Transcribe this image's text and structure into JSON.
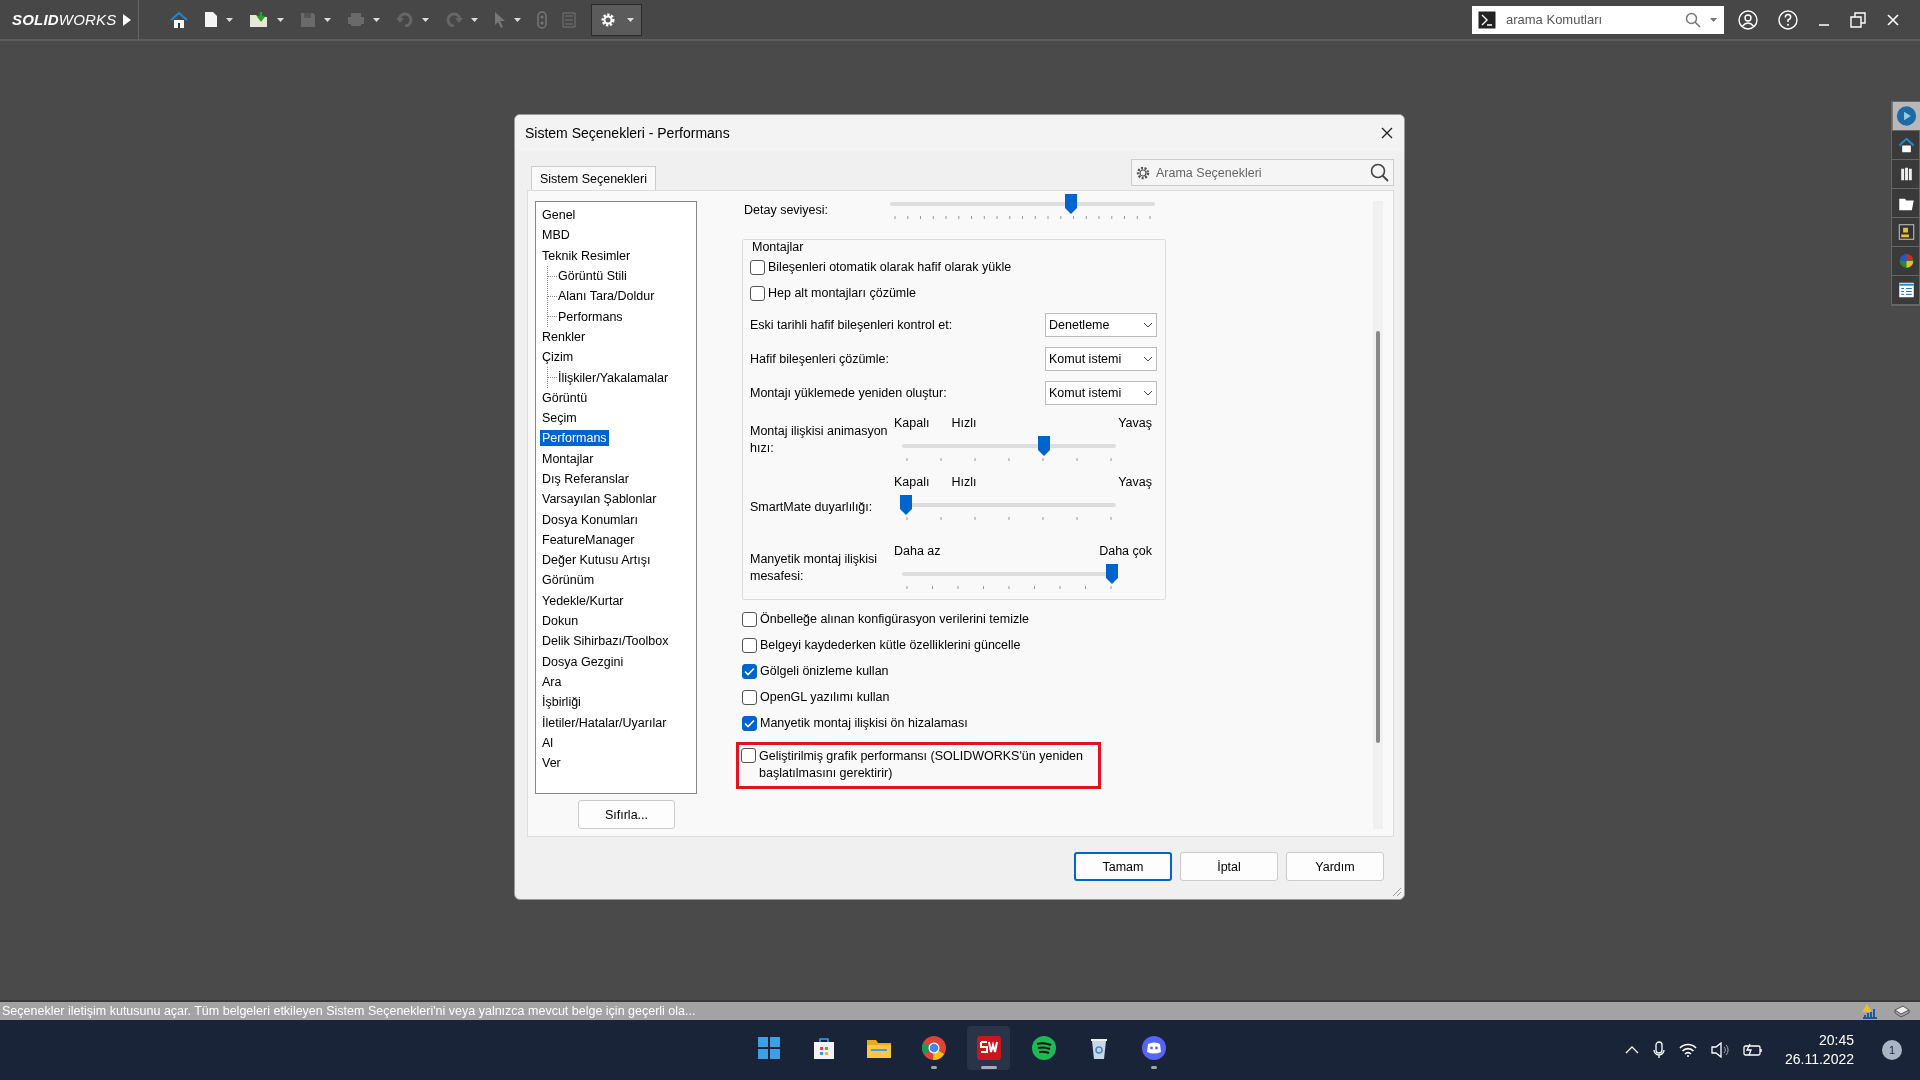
{
  "app": {
    "logo": "**SOLID**WORKS",
    "search": {
      "placeholder": "arama Komutları"
    }
  },
  "dialog": {
    "title": "Sistem Seçenekleri - Performans",
    "tabs": [
      {
        "label": "Sistem Seçenekleri",
        "selected": true
      }
    ],
    "search": {
      "placeholder": "Arama Seçenekleri"
    },
    "tree": [
      {
        "label": "Genel",
        "selected": false
      },
      {
        "label": "MBD",
        "selected": false
      },
      {
        "label": "Teknik Resimler",
        "selected": false,
        "children": [
          {
            "label": "Görüntü Stili",
            "selected": false
          },
          {
            "label": "Alanı Tara/Doldur",
            "selected": false
          },
          {
            "label": "Performans",
            "selected": false
          }
        ]
      },
      {
        "label": "Renkler",
        "selected": false
      },
      {
        "label": "Çizim",
        "selected": false,
        "children": [
          {
            "label": "İlişkiler/Yakalamalar",
            "selected": false
          }
        ]
      },
      {
        "label": "Görüntü",
        "selected": false
      },
      {
        "label": "Seçim",
        "selected": false
      },
      {
        "label": "Performans",
        "selected": true
      },
      {
        "label": "Montajlar",
        "selected": false
      },
      {
        "label": "Dış Referanslar",
        "selected": false
      },
      {
        "label": "Varsayılan Şablonlar",
        "selected": false
      },
      {
        "label": "Dosya Konumları",
        "selected": false
      },
      {
        "label": "FeatureManager",
        "selected": false
      },
      {
        "label": "Değer Kutusu Artışı",
        "selected": false
      },
      {
        "label": "Görünüm",
        "selected": false
      },
      {
        "label": "Yedekle/Kurtar",
        "selected": false
      },
      {
        "label": "Dokun",
        "selected": false
      },
      {
        "label": "Delik Sihirbazı/Toolbox",
        "selected": false
      },
      {
        "label": "Dosya Gezgini",
        "selected": false
      },
      {
        "label": "Ara",
        "selected": false
      },
      {
        "label": "İşbirliği",
        "selected": false
      },
      {
        "label": "İletiler/Hatalar/Uyarılar",
        "selected": false
      },
      {
        "label": "Al",
        "selected": false
      },
      {
        "label": "Ver",
        "selected": false
      }
    ],
    "reset_button": "Sıfırla...",
    "detail": {
      "label": "Detay seviyesi:",
      "level": 0.69
    },
    "group": {
      "title": "Montajlar",
      "checkboxes": [
        {
          "label": "Bileşenleri otomatik olarak hafif olarak yükle",
          "checked": false
        },
        {
          "label": "Hep alt montajları çözümle",
          "checked": false
        }
      ],
      "dropdowns": [
        {
          "label": "Eski tarihli hafif bileşenleri kontrol et:",
          "value": "Denetleme"
        },
        {
          "label": "Hafif bileşenleri çözümle:",
          "value": "Komut istemi"
        },
        {
          "label": "Montajı yüklemede yeniden oluştur:",
          "value": "Komut istemi"
        }
      ],
      "sliders": [
        {
          "label": "Montaj ilişkisi animasyon hızı:",
          "marks": [
            "Kapalı",
            "Hızlı",
            "Yavaş"
          ],
          "level": 0.67
        },
        {
          "label": "SmartMate duyarlılığı:",
          "marks": [
            "Kapalı",
            "Hızlı",
            "Yavaş"
          ],
          "level": 0.0
        },
        {
          "label": "Manyetik montaj ilişkisi mesafesi:",
          "marks": [
            "Daha az",
            "Daha çok"
          ],
          "level": 1.0
        }
      ]
    },
    "options": [
      {
        "label": "Önbelleğe alınan konfigürasyon verilerini temizle",
        "checked": false,
        "highlighted": false
      },
      {
        "label": "Belgeyi kaydederken kütle özelliklerini güncelle",
        "checked": false,
        "highlighted": false
      },
      {
        "label": "Gölgeli önizleme kullan",
        "checked": true,
        "highlighted": false
      },
      {
        "label": "OpenGL yazılımı kullan",
        "checked": false,
        "highlighted": false
      },
      {
        "label": "Manyetik montaj ilişkisi ön hizalaması",
        "checked": true,
        "highlighted": false
      },
      {
        "label": "Geliştirilmiş grafik performansı (SOLIDWORKS'ün yeniden başlatılmasını gerektirir)",
        "checked": false,
        "highlighted": true
      }
    ],
    "buttons": [
      {
        "label": "Tamam",
        "default": true
      },
      {
        "label": "İptal",
        "default": false
      },
      {
        "label": "Yardım",
        "default": false
      }
    ]
  },
  "status_bar": {
    "text": "Seçenekler iletişim kutusunu açar. Tüm belgeleri etkileyen Sistem Seçenekleri'ni veya yalnızca mevcut belge için geçerli ola..."
  },
  "taskbar": {
    "time": "20:45",
    "date": "26.11.2022",
    "notifications": "1"
  }
}
